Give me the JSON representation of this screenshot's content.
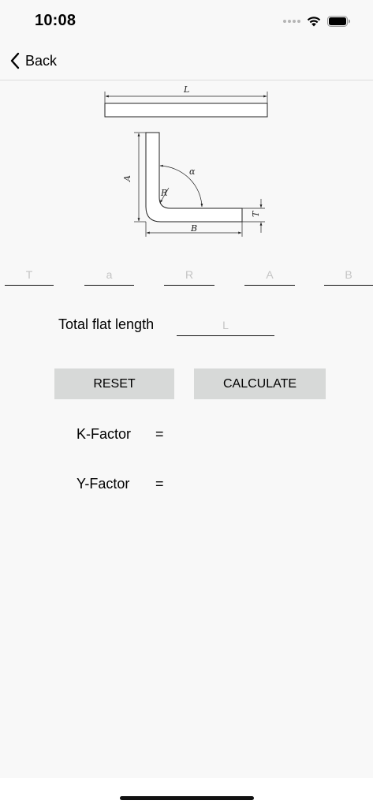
{
  "status_bar": {
    "time": "10:08"
  },
  "nav": {
    "back_label": "Back"
  },
  "diagram": {
    "labels": {
      "L": "L",
      "A": "A",
      "alpha": "α",
      "R": "R",
      "T": "T",
      "B": "B"
    }
  },
  "inputs": [
    {
      "name": "T",
      "placeholder": "T",
      "value": ""
    },
    {
      "name": "a",
      "placeholder": "a",
      "value": ""
    },
    {
      "name": "R",
      "placeholder": "R",
      "value": ""
    },
    {
      "name": "A",
      "placeholder": "A",
      "value": ""
    },
    {
      "name": "B",
      "placeholder": "B",
      "value": ""
    }
  ],
  "total_flat": {
    "label": "Total flat length",
    "placeholder": "L",
    "value": ""
  },
  "buttons": {
    "reset": "RESET",
    "calculate": "CALCULATE"
  },
  "results": {
    "k_factor": {
      "label": "K-Factor",
      "eq": "=",
      "value": ""
    },
    "y_factor": {
      "label": "Y-Factor",
      "eq": "=",
      "value": ""
    }
  },
  "colors": {
    "background": "#f8f8f8",
    "button_bg": "#d7d9d8",
    "placeholder": "#c4c4c4"
  }
}
